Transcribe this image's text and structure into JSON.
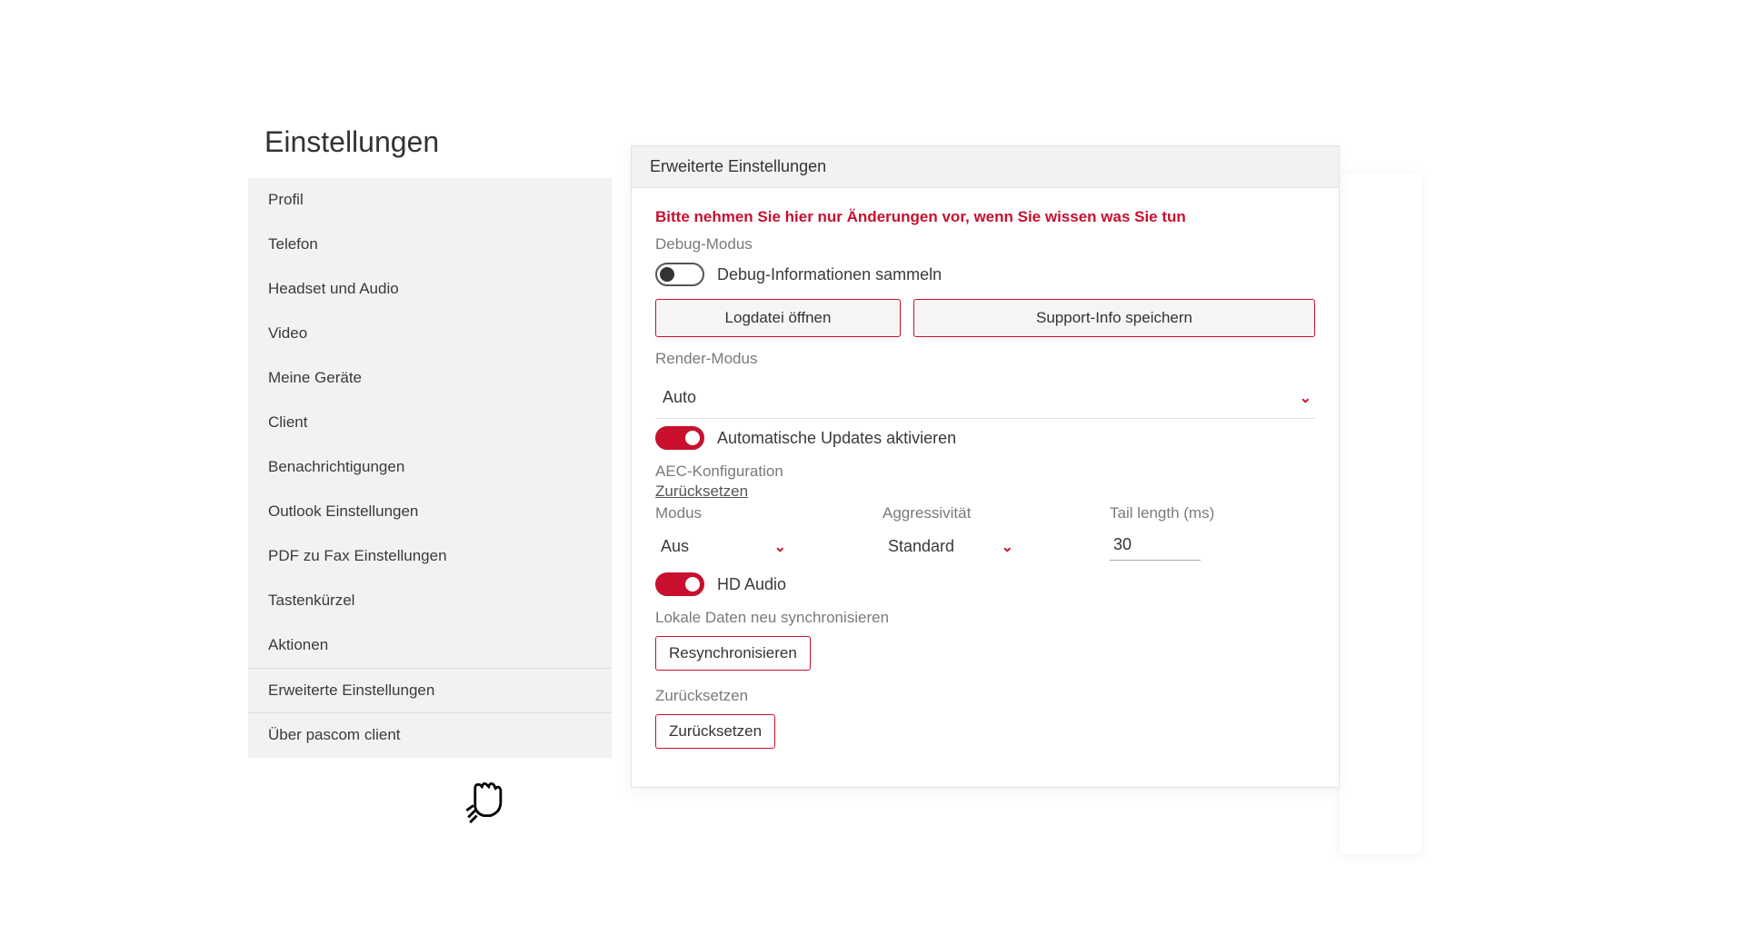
{
  "page_title": "Einstellungen",
  "sidebar": {
    "items": [
      {
        "label": "Profil"
      },
      {
        "label": "Telefon"
      },
      {
        "label": "Headset und Audio"
      },
      {
        "label": "Video"
      },
      {
        "label": "Meine Geräte"
      },
      {
        "label": "Client"
      },
      {
        "label": "Benachrichtigungen"
      },
      {
        "label": "Outlook Einstellungen"
      },
      {
        "label": "PDF zu Fax Einstellungen"
      },
      {
        "label": "Tastenkürzel"
      },
      {
        "label": "Aktionen"
      },
      {
        "label": "Erweiterte Einstellungen"
      },
      {
        "label": "Über pascom client"
      }
    ]
  },
  "panel": {
    "title": "Erweiterte Einstellungen",
    "warning": "Bitte nehmen Sie hier nur Änderungen vor, wenn Sie wissen was Sie tun",
    "debug_mode_label": "Debug-Modus",
    "debug_toggle_label": "Debug-Informationen sammeln",
    "open_logfile": "Logdatei öffnen",
    "save_support_info": "Support-Info speichern",
    "render_mode_label": "Render-Modus",
    "render_mode_value": "Auto",
    "auto_updates_label": "Automatische Updates aktivieren",
    "aec_label": "AEC-Konfiguration",
    "aec_reset": "Zurücksetzen",
    "aec_modus_label": "Modus",
    "aec_modus_value": "Aus",
    "aec_aggr_label": "Aggressivität",
    "aec_aggr_value": "Standard",
    "aec_tail_label": "Tail length (ms)",
    "aec_tail_value": "30",
    "hd_audio_label": "HD Audio",
    "resync_label": "Lokale Daten neu synchronisieren",
    "resync_button": "Resynchronisieren",
    "reset_label": "Zurücksetzen",
    "reset_button": "Zurücksetzen"
  },
  "colors": {
    "accent": "#c8102e"
  }
}
